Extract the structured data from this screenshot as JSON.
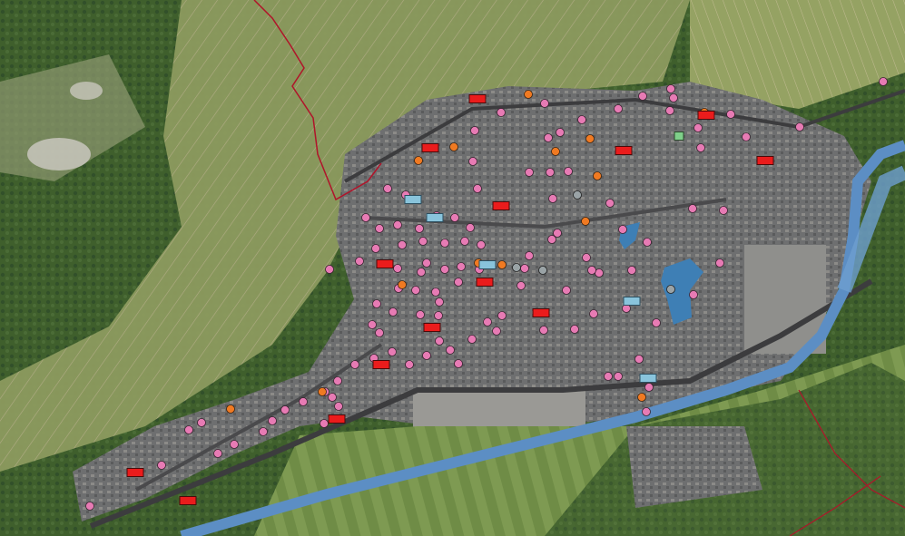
{
  "map": {
    "base_layer": "aerial-orthophoto",
    "terrain_colors": {
      "forest": "#3f5f2c",
      "vineyard": "#8c9a5e",
      "urban": "#6f6f70",
      "road": "#3c3c3e",
      "river": "#5c8ec4",
      "lake": "#3e7fb5",
      "fields": "#7e9a52",
      "boundary": "#b0142a"
    },
    "marker_styles": {
      "pink_circle": {
        "fill": "#e77bb4",
        "stroke": "#3a2230",
        "shape": "circle"
      },
      "orange_circle": {
        "fill": "#f07a22",
        "stroke": "#3a2210",
        "shape": "circle"
      },
      "grey_circle": {
        "fill": "#9aa3a6",
        "stroke": "#222",
        "shape": "circle"
      },
      "red_rect": {
        "fill": "#ea1c1c",
        "stroke": "#4a0a0a",
        "shape": "rect"
      },
      "blue_rect": {
        "fill": "#89c4dc",
        "stroke": "#2d4f60",
        "shape": "rect"
      },
      "green_rect": {
        "fill": "#7fd08a",
        "stroke": "#2a4a2a",
        "shape": "rect"
      }
    },
    "marker_counts": {
      "pink_circle": 110,
      "orange_circle": 14,
      "grey_circle": 4,
      "red_rect": 16,
      "blue_rect": 5,
      "green_rect": 1
    }
  }
}
